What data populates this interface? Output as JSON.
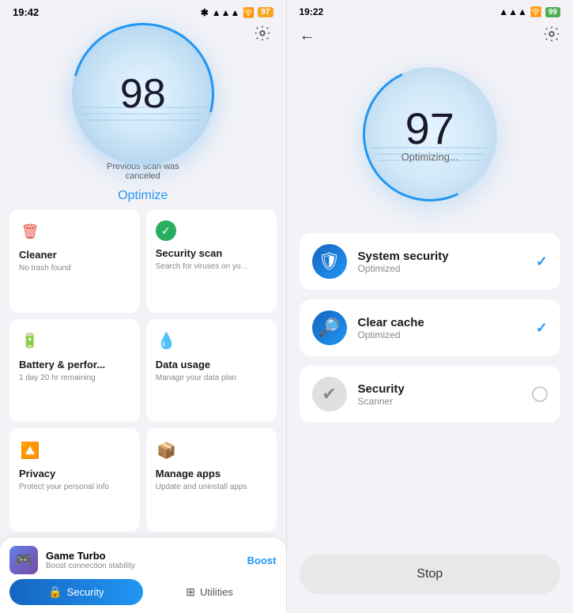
{
  "left": {
    "statusBar": {
      "time": "19:42",
      "batteryPercent": "97"
    },
    "score": {
      "number": "98",
      "subtitle": "Previous scan was canceled",
      "optimizeLabel": "Optimize"
    },
    "features": [
      {
        "id": "cleaner",
        "icon": "🗑",
        "iconColor": "icon-red",
        "title": "Cleaner",
        "desc": "No trash found"
      },
      {
        "id": "security",
        "icon": "✔",
        "iconColor": "icon-green",
        "title": "Security scan",
        "desc": "Search for viruses on yo..."
      },
      {
        "id": "battery",
        "icon": "🔋",
        "iconColor": "icon-green2",
        "title": "Battery & perfor...",
        "desc": "1 day 20 hr  remaining"
      },
      {
        "id": "data",
        "icon": "💧",
        "iconColor": "icon-blue",
        "title": "Data usage",
        "desc": "Manage your data plan"
      },
      {
        "id": "privacy",
        "icon": "🔼",
        "iconColor": "icon-teal",
        "title": "Privacy",
        "desc": "Protect your personal info"
      },
      {
        "id": "apps",
        "icon": "📦",
        "iconColor": "icon-purple",
        "title": "Manage apps",
        "desc": "Update and uninstall apps"
      }
    ],
    "gameTurbo": {
      "title": "Game Turbo",
      "desc": "Boost connection stability",
      "boostLabel": "Boost"
    },
    "tabs": [
      {
        "id": "security-tab",
        "label": "Security",
        "active": true
      },
      {
        "id": "utilities-tab",
        "label": "Utilities",
        "active": false
      }
    ]
  },
  "right": {
    "statusBar": {
      "time": "19:22",
      "batteryPercent": "99"
    },
    "score": {
      "number": "97",
      "label": "Optimizing..."
    },
    "items": [
      {
        "id": "system-security",
        "title": "System security",
        "subtitle": "Optimized",
        "status": "done"
      },
      {
        "id": "clear-cache",
        "title": "Clear cache",
        "subtitle": "Optimized",
        "status": "done"
      },
      {
        "id": "security-scanner",
        "title": "Security",
        "subtitle": "Scanner",
        "status": "loading"
      }
    ],
    "stopButton": "Stop"
  }
}
